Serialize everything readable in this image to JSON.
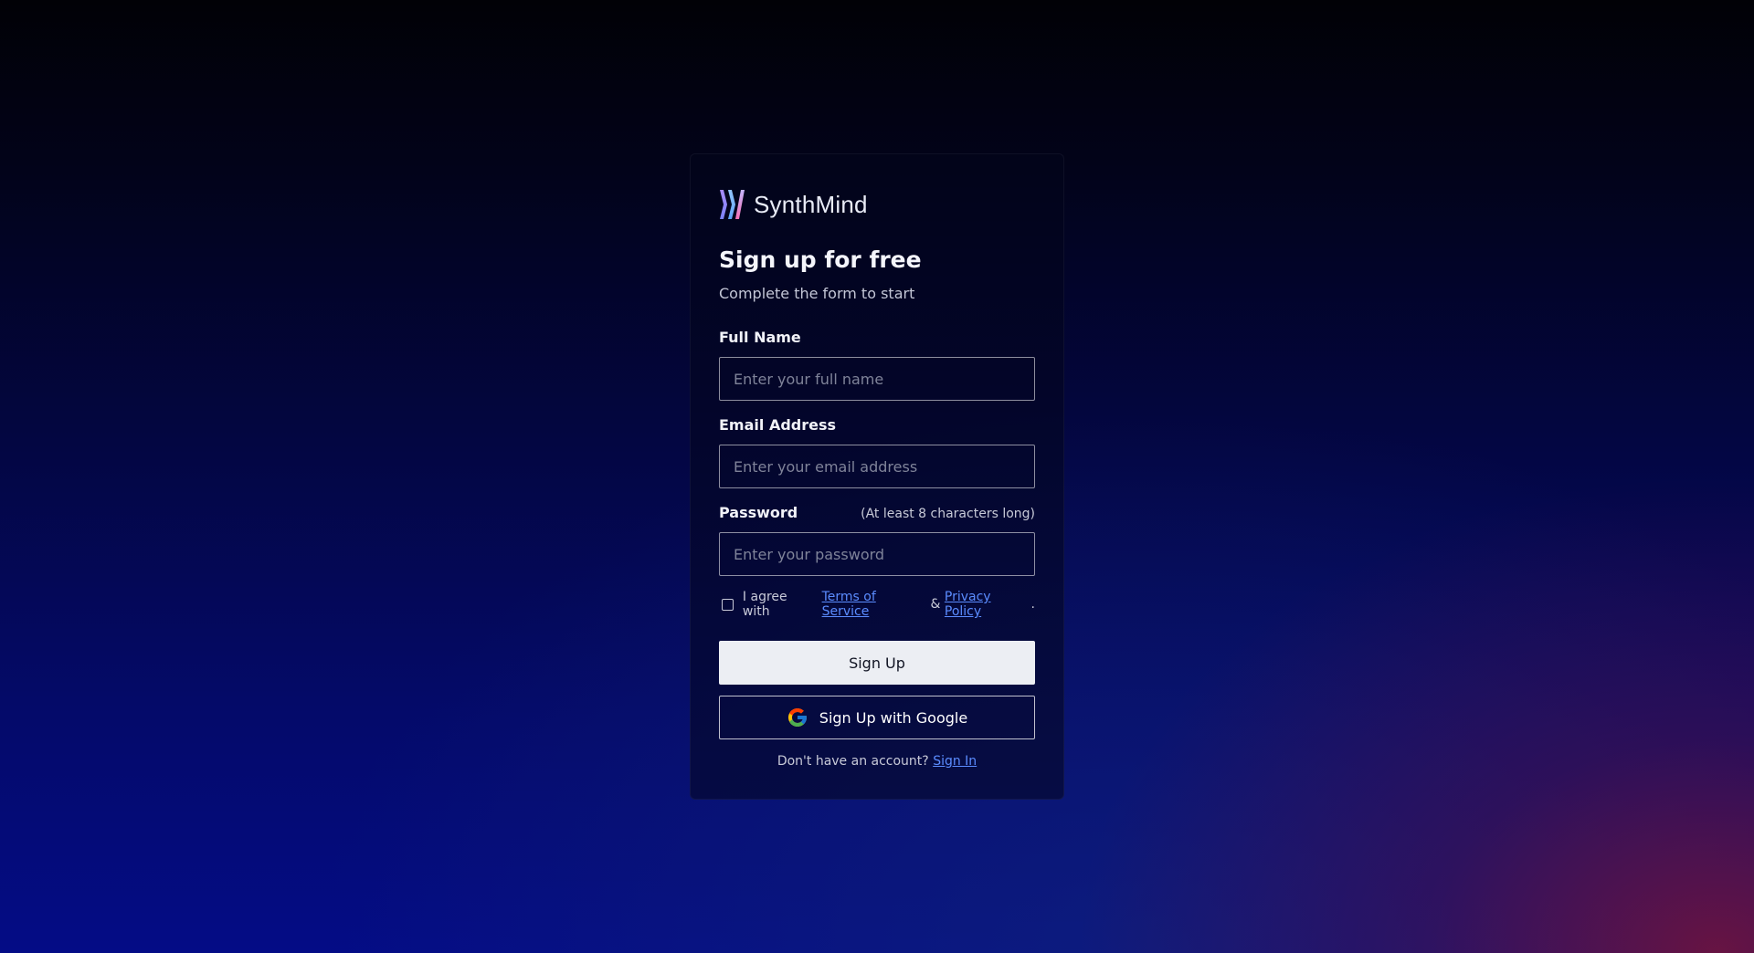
{
  "brand": {
    "name": "SynthMind",
    "logo_icon": "synthmind-logo-icon",
    "logo_colors": [
      "#a78bfa",
      "#60a5fa",
      "#f472b6"
    ]
  },
  "form": {
    "title": "Sign up for free",
    "subtitle": "Complete the form to start",
    "full_name": {
      "label": "Full Name",
      "placeholder": "Enter your full name",
      "value": ""
    },
    "email": {
      "label": "Email Address",
      "placeholder": "Enter your email address",
      "value": ""
    },
    "password": {
      "label": "Password",
      "hint": "(At least 8 characters long)",
      "placeholder": "Enter your password",
      "value": ""
    },
    "agree": {
      "checked": false,
      "prefix": "I agree with",
      "terms_link": "Terms of Service",
      "separator": "&",
      "privacy_link": "Privacy Policy",
      "suffix": "."
    },
    "signup_button": "Sign Up",
    "google_button": "Sign Up with Google",
    "google_icon": "google-icon",
    "footer_prompt": "Don't have an account?",
    "signin_link": "Sign In"
  },
  "colors": {
    "link": "#5b8cff",
    "primary_button_bg": "#eceef3",
    "card_border": "rgba(255,255,255,0.05)"
  }
}
